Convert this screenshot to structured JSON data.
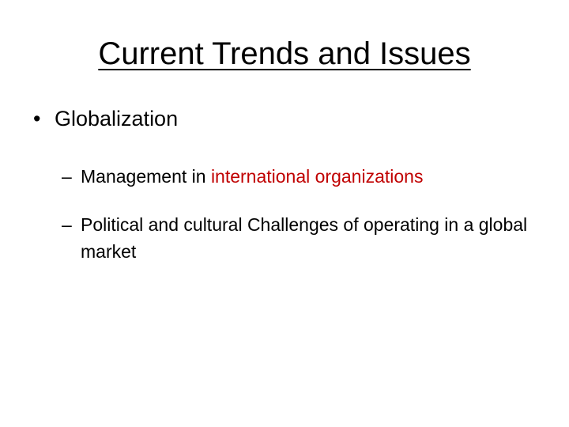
{
  "slide": {
    "title": "Current Trends and Issues",
    "bullet": {
      "marker": "•",
      "text": "Globalization"
    },
    "sub_items": [
      {
        "marker": "–",
        "text_before": "Management in ",
        "text_highlight": "international organizations"
      },
      {
        "marker": "–",
        "text": "Political and cultural Challenges of operating in a global market"
      }
    ]
  },
  "colors": {
    "background": "#ffffff",
    "text": "#000000",
    "highlight": "#c00000"
  }
}
